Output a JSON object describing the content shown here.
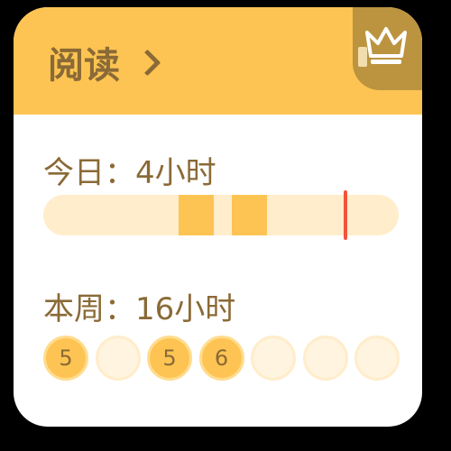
{
  "colors": {
    "accent": "#FDC453",
    "accent_dark": "#BC9440",
    "track": "#FFEDCB",
    "text": "#8A6A36",
    "marker": "#F2543B"
  },
  "header": {
    "title": "阅读",
    "link_icon": "chevron-right-icon",
    "badge_icon": "crown-icon"
  },
  "today": {
    "label": "今日：4小时",
    "timeline": {
      "reading_segments": [
        {
          "start_fraction": 0.38,
          "end_fraction": 0.48
        },
        {
          "start_fraction": 0.53,
          "end_fraction": 0.63
        }
      ],
      "current_time_fraction": 0.85
    }
  },
  "week": {
    "label": "本周：16小时",
    "days": [
      {
        "value": "5",
        "done": true
      },
      {
        "value": "",
        "done": false
      },
      {
        "value": "5",
        "done": true
      },
      {
        "value": "6",
        "done": true
      },
      {
        "value": "",
        "done": false
      },
      {
        "value": "",
        "done": false
      },
      {
        "value": "",
        "done": false
      }
    ]
  }
}
